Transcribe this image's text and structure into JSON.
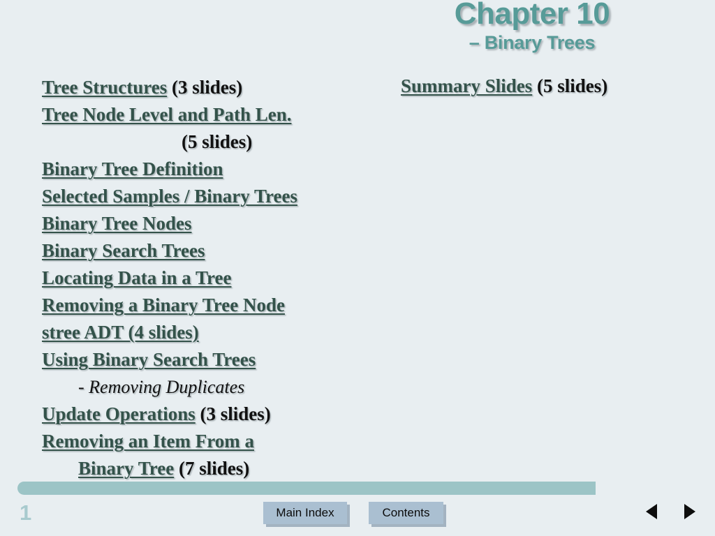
{
  "slide": {
    "title": "Chapter 10",
    "subtitle": "– Binary Trees",
    "page_number": "1",
    "accent_color": "#579b98",
    "link_color": "#33524a",
    "background_color": "#e8eef1",
    "button_color": "#aabfd1",
    "bar_color": "#9cc4c6"
  },
  "left_column": {
    "entries": [
      {
        "link": "Tree Structures",
        "suffix": " (3 slides)"
      },
      {
        "link": "Tree Node Level and Path Len.",
        "suffix": ""
      },
      {
        "link": "",
        "suffix": "(5 slides)",
        "style": "indent-center"
      },
      {
        "link": "Binary Tree Definition",
        "suffix": ""
      },
      {
        "link": "Selected Samples / Binary Trees",
        "suffix": ""
      },
      {
        "link": "Binary Tree Nodes",
        "suffix": ""
      },
      {
        "link": "Binary Search Trees",
        "suffix": ""
      },
      {
        "link": "Locating Data in a Tree",
        "suffix": ""
      },
      {
        "link": "Removing a Binary Tree Node",
        "suffix": ""
      },
      {
        "link": "stree ADT (4 slides)",
        "suffix": ""
      },
      {
        "link": "Using Binary Search Trees",
        "suffix": ""
      },
      {
        "link": "",
        "suffix": "- Removing Duplicates",
        "style": "indent-sub"
      },
      {
        "link": "Update Operations",
        "suffix": " (3 slides)"
      },
      {
        "link": "Removing an Item From a",
        "suffix": ""
      },
      {
        "link": "Binary Tree",
        "suffix": " (7 slides)",
        "style": "indent-cont"
      }
    ]
  },
  "right_column": {
    "entries": [
      {
        "link": "Summary Slides",
        "suffix": " (5 slides)"
      }
    ]
  },
  "footer": {
    "main_index_label": "Main Index",
    "contents_label": "Contents",
    "prev_icon": "triangle-left-icon",
    "next_icon": "triangle-right-icon"
  }
}
